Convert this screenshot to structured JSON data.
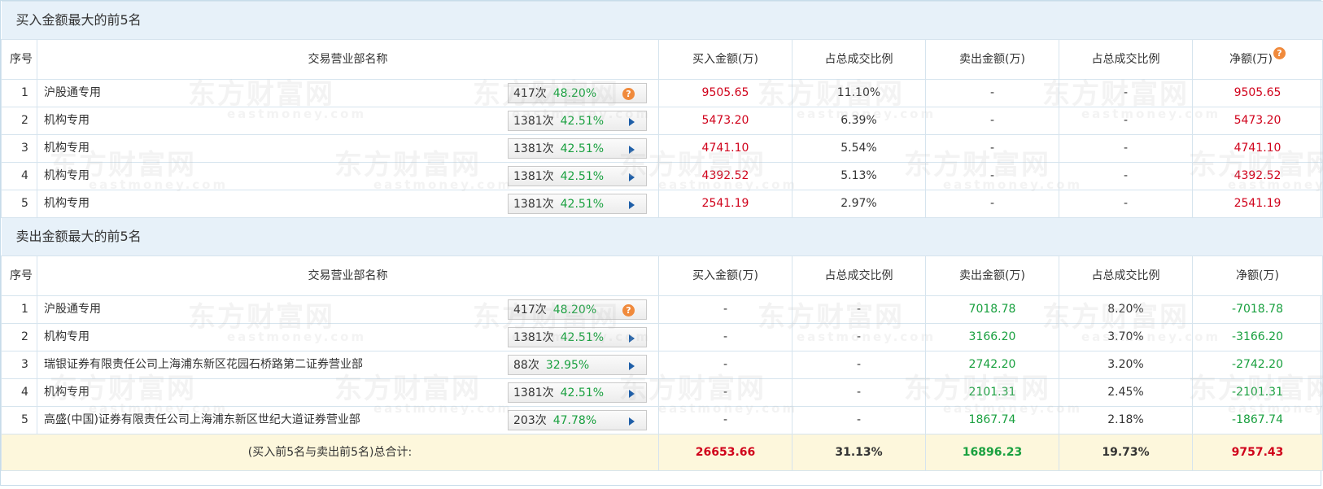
{
  "buy_section": {
    "title": "买入金额最大的前5名",
    "headers": [
      "序号",
      "交易营业部名称",
      "买入金额(万)",
      "占总成交比例",
      "卖出金额(万)",
      "占总成交比例",
      "净额(万)"
    ],
    "net_help_icon": "question-icon",
    "rows": [
      {
        "idx": "1",
        "name": "沪股通专用",
        "count": "417次",
        "pct": "48.20%",
        "icon": "question-icon",
        "buy": "9505.65",
        "buy_ratio": "11.10%",
        "sell": "-",
        "sell_ratio": "-",
        "net": "9505.65"
      },
      {
        "idx": "2",
        "name": "机构专用",
        "count": "1381次",
        "pct": "42.51%",
        "icon": "arrow-right-icon",
        "buy": "5473.20",
        "buy_ratio": "6.39%",
        "sell": "-",
        "sell_ratio": "-",
        "net": "5473.20"
      },
      {
        "idx": "3",
        "name": "机构专用",
        "count": "1381次",
        "pct": "42.51%",
        "icon": "arrow-right-icon",
        "buy": "4741.10",
        "buy_ratio": "5.54%",
        "sell": "-",
        "sell_ratio": "-",
        "net": "4741.10"
      },
      {
        "idx": "4",
        "name": "机构专用",
        "count": "1381次",
        "pct": "42.51%",
        "icon": "arrow-right-icon",
        "buy": "4392.52",
        "buy_ratio": "5.13%",
        "sell": "-",
        "sell_ratio": "-",
        "net": "4392.52"
      },
      {
        "idx": "5",
        "name": "机构专用",
        "count": "1381次",
        "pct": "42.51%",
        "icon": "arrow-right-icon",
        "buy": "2541.19",
        "buy_ratio": "2.97%",
        "sell": "-",
        "sell_ratio": "-",
        "net": "2541.19"
      }
    ]
  },
  "sell_section": {
    "title": "卖出金额最大的前5名",
    "headers": [
      "序号",
      "交易营业部名称",
      "买入金额(万)",
      "占总成交比例",
      "卖出金额(万)",
      "占总成交比例",
      "净额(万)"
    ],
    "rows": [
      {
        "idx": "1",
        "name": "沪股通专用",
        "count": "417次",
        "pct": "48.20%",
        "icon": "question-icon",
        "buy": "-",
        "buy_ratio": "-",
        "sell": "7018.78",
        "sell_ratio": "8.20%",
        "net": "-7018.78"
      },
      {
        "idx": "2",
        "name": "机构专用",
        "count": "1381次",
        "pct": "42.51%",
        "icon": "arrow-right-icon",
        "buy": "-",
        "buy_ratio": "-",
        "sell": "3166.20",
        "sell_ratio": "3.70%",
        "net": "-3166.20"
      },
      {
        "idx": "3",
        "name": "瑞银证券有限责任公司上海浦东新区花园石桥路第二证券营业部",
        "count": "88次",
        "pct": "32.95%",
        "icon": "arrow-right-icon",
        "buy": "-",
        "buy_ratio": "-",
        "sell": "2742.20",
        "sell_ratio": "3.20%",
        "net": "-2742.20"
      },
      {
        "idx": "4",
        "name": "机构专用",
        "count": "1381次",
        "pct": "42.51%",
        "icon": "arrow-right-icon",
        "buy": "-",
        "buy_ratio": "-",
        "sell": "2101.31",
        "sell_ratio": "2.45%",
        "net": "-2101.31"
      },
      {
        "idx": "5",
        "name": "高盛(中国)证券有限责任公司上海浦东新区世纪大道证券营业部",
        "count": "203次",
        "pct": "47.78%",
        "icon": "arrow-right-icon",
        "buy": "-",
        "buy_ratio": "-",
        "sell": "1867.74",
        "sell_ratio": "2.18%",
        "net": "-1867.74"
      }
    ]
  },
  "total": {
    "label": "(买入前5名与卖出前5名)总合计:",
    "buy": "26653.66",
    "buy_ratio": "31.13%",
    "sell": "16896.23",
    "sell_ratio": "19.73%",
    "net": "9757.43"
  },
  "watermark": {
    "brand": "东方财富网",
    "domain": "eastmoney.com"
  },
  "colors": {
    "positive": "#d0021b",
    "negative": "#19a03f",
    "section_bg": "#e7f1f9",
    "total_bg": "#fdf7dc",
    "help_icon": "#f08a3c",
    "arrow_icon": "#1f5fa8"
  }
}
